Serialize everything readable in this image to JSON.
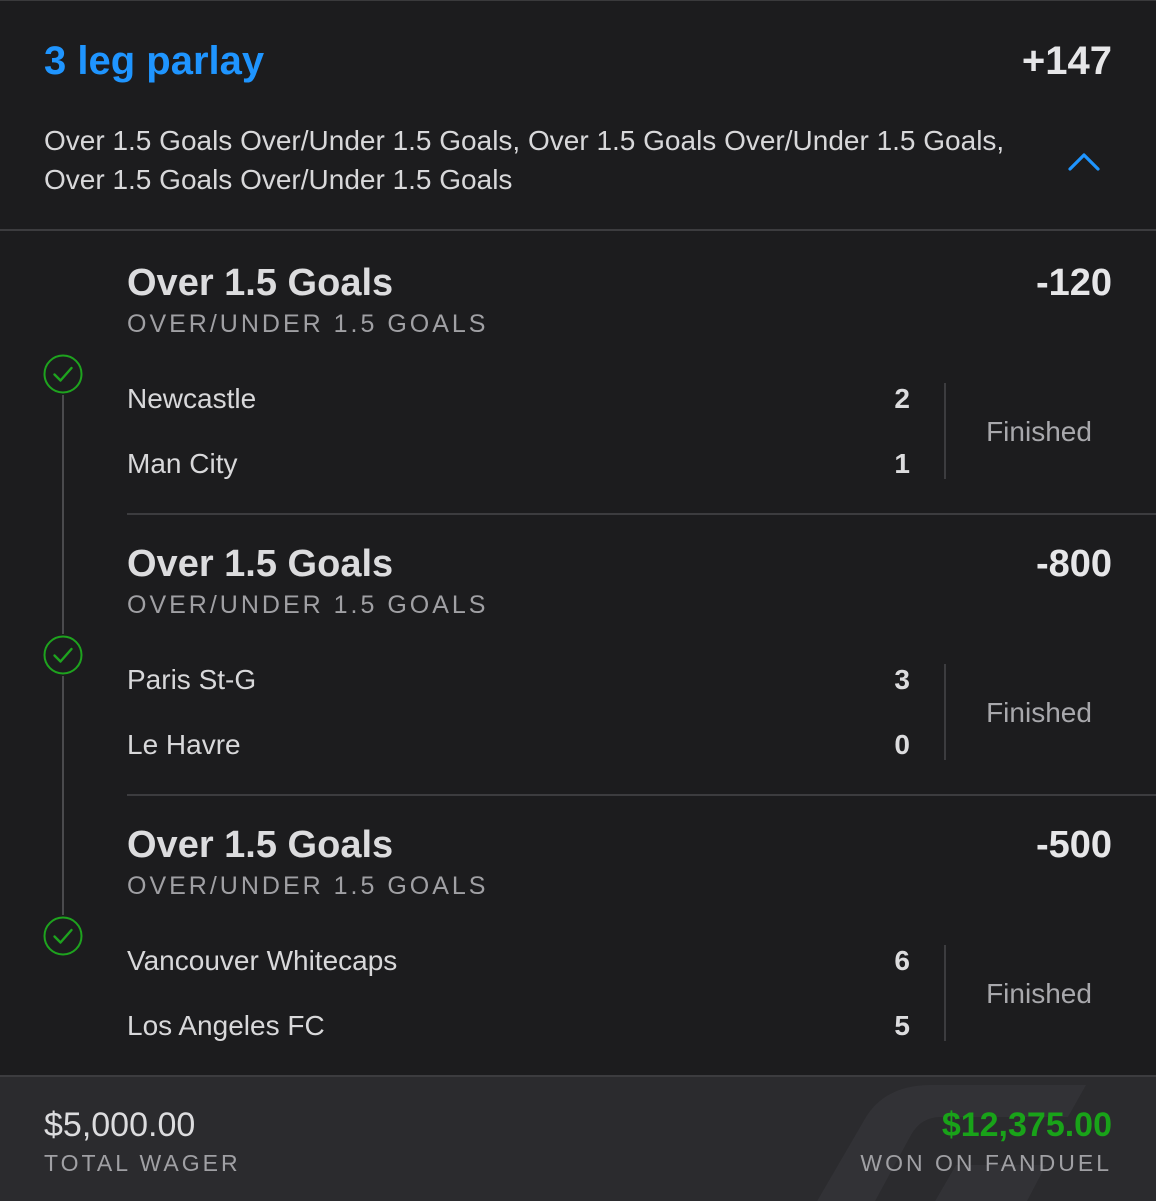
{
  "header": {
    "title": "3 leg parlay",
    "odds": "+147",
    "description": "Over 1.5 Goals Over/Under 1.5 Goals, Over 1.5 Goals Over/Under 1.5 Goals, Over 1.5 Goals Over/Under 1.5 Goals",
    "collapse_icon": "chevron-up-icon"
  },
  "legs": [
    {
      "selection": "Over 1.5 Goals",
      "market": "OVER/UNDER 1.5 GOALS",
      "odds": "-120",
      "result_icon": "check-circle-icon",
      "teams": [
        {
          "name": "Newcastle",
          "score": "2"
        },
        {
          "name": "Man City",
          "score": "1"
        }
      ],
      "status": "Finished"
    },
    {
      "selection": "Over 1.5 Goals",
      "market": "OVER/UNDER 1.5 GOALS",
      "odds": "-800",
      "result_icon": "check-circle-icon",
      "teams": [
        {
          "name": "Paris St-G",
          "score": "3"
        },
        {
          "name": "Le Havre",
          "score": "0"
        }
      ],
      "status": "Finished"
    },
    {
      "selection": "Over 1.5 Goals",
      "market": "OVER/UNDER 1.5 GOALS",
      "odds": "-500",
      "result_icon": "check-circle-icon",
      "teams": [
        {
          "name": "Vancouver Whitecaps",
          "score": "6"
        },
        {
          "name": "Los Angeles FC",
          "score": "5"
        }
      ],
      "status": "Finished"
    }
  ],
  "footer": {
    "wager_amount": "$5,000.00",
    "wager_label": "TOTAL WAGER",
    "won_amount": "$12,375.00",
    "won_label": "WON ON FANDUEL"
  },
  "colors": {
    "accent": "#1f95ff",
    "win": "#19a319",
    "background": "#1c1c1e",
    "footer_bg": "#2b2b2e"
  }
}
